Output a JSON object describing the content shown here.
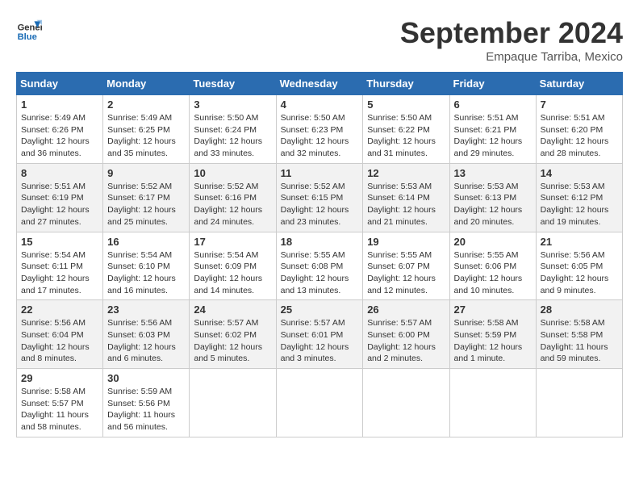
{
  "logo": {
    "line1": "General",
    "line2": "Blue"
  },
  "title": "September 2024",
  "location": "Empaque Tarriba, Mexico",
  "header": {
    "days": [
      "Sunday",
      "Monday",
      "Tuesday",
      "Wednesday",
      "Thursday",
      "Friday",
      "Saturday"
    ]
  },
  "weeks": [
    [
      {
        "day": "1",
        "sunrise": "5:49 AM",
        "sunset": "6:26 PM",
        "daylight": "12 hours and 36 minutes."
      },
      {
        "day": "2",
        "sunrise": "5:49 AM",
        "sunset": "6:25 PM",
        "daylight": "12 hours and 35 minutes."
      },
      {
        "day": "3",
        "sunrise": "5:50 AM",
        "sunset": "6:24 PM",
        "daylight": "12 hours and 33 minutes."
      },
      {
        "day": "4",
        "sunrise": "5:50 AM",
        "sunset": "6:23 PM",
        "daylight": "12 hours and 32 minutes."
      },
      {
        "day": "5",
        "sunrise": "5:50 AM",
        "sunset": "6:22 PM",
        "daylight": "12 hours and 31 minutes."
      },
      {
        "day": "6",
        "sunrise": "5:51 AM",
        "sunset": "6:21 PM",
        "daylight": "12 hours and 29 minutes."
      },
      {
        "day": "7",
        "sunrise": "5:51 AM",
        "sunset": "6:20 PM",
        "daylight": "12 hours and 28 minutes."
      }
    ],
    [
      {
        "day": "8",
        "sunrise": "5:51 AM",
        "sunset": "6:19 PM",
        "daylight": "12 hours and 27 minutes."
      },
      {
        "day": "9",
        "sunrise": "5:52 AM",
        "sunset": "6:17 PM",
        "daylight": "12 hours and 25 minutes."
      },
      {
        "day": "10",
        "sunrise": "5:52 AM",
        "sunset": "6:16 PM",
        "daylight": "12 hours and 24 minutes."
      },
      {
        "day": "11",
        "sunrise": "5:52 AM",
        "sunset": "6:15 PM",
        "daylight": "12 hours and 23 minutes."
      },
      {
        "day": "12",
        "sunrise": "5:53 AM",
        "sunset": "6:14 PM",
        "daylight": "12 hours and 21 minutes."
      },
      {
        "day": "13",
        "sunrise": "5:53 AM",
        "sunset": "6:13 PM",
        "daylight": "12 hours and 20 minutes."
      },
      {
        "day": "14",
        "sunrise": "5:53 AM",
        "sunset": "6:12 PM",
        "daylight": "12 hours and 19 minutes."
      }
    ],
    [
      {
        "day": "15",
        "sunrise": "5:54 AM",
        "sunset": "6:11 PM",
        "daylight": "12 hours and 17 minutes."
      },
      {
        "day": "16",
        "sunrise": "5:54 AM",
        "sunset": "6:10 PM",
        "daylight": "12 hours and 16 minutes."
      },
      {
        "day": "17",
        "sunrise": "5:54 AM",
        "sunset": "6:09 PM",
        "daylight": "12 hours and 14 minutes."
      },
      {
        "day": "18",
        "sunrise": "5:55 AM",
        "sunset": "6:08 PM",
        "daylight": "12 hours and 13 minutes."
      },
      {
        "day": "19",
        "sunrise": "5:55 AM",
        "sunset": "6:07 PM",
        "daylight": "12 hours and 12 minutes."
      },
      {
        "day": "20",
        "sunrise": "5:55 AM",
        "sunset": "6:06 PM",
        "daylight": "12 hours and 10 minutes."
      },
      {
        "day": "21",
        "sunrise": "5:56 AM",
        "sunset": "6:05 PM",
        "daylight": "12 hours and 9 minutes."
      }
    ],
    [
      {
        "day": "22",
        "sunrise": "5:56 AM",
        "sunset": "6:04 PM",
        "daylight": "12 hours and 8 minutes."
      },
      {
        "day": "23",
        "sunrise": "5:56 AM",
        "sunset": "6:03 PM",
        "daylight": "12 hours and 6 minutes."
      },
      {
        "day": "24",
        "sunrise": "5:57 AM",
        "sunset": "6:02 PM",
        "daylight": "12 hours and 5 minutes."
      },
      {
        "day": "25",
        "sunrise": "5:57 AM",
        "sunset": "6:01 PM",
        "daylight": "12 hours and 3 minutes."
      },
      {
        "day": "26",
        "sunrise": "5:57 AM",
        "sunset": "6:00 PM",
        "daylight": "12 hours and 2 minutes."
      },
      {
        "day": "27",
        "sunrise": "5:58 AM",
        "sunset": "5:59 PM",
        "daylight": "12 hours and 1 minute."
      },
      {
        "day": "28",
        "sunrise": "5:58 AM",
        "sunset": "5:58 PM",
        "daylight": "11 hours and 59 minutes."
      }
    ],
    [
      {
        "day": "29",
        "sunrise": "5:58 AM",
        "sunset": "5:57 PM",
        "daylight": "11 hours and 58 minutes."
      },
      {
        "day": "30",
        "sunrise": "5:59 AM",
        "sunset": "5:56 PM",
        "daylight": "11 hours and 56 minutes."
      },
      null,
      null,
      null,
      null,
      null
    ]
  ],
  "labels": {
    "sunrise": "Sunrise:",
    "sunset": "Sunset:",
    "daylight": "Daylight:"
  }
}
